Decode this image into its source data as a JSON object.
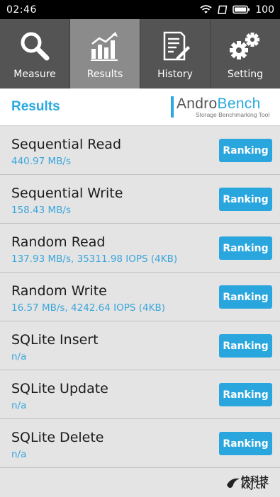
{
  "status_bar": {
    "time": "02:46",
    "battery": "100",
    "icons": [
      "wifi-icon",
      "signal-icon",
      "battery-icon"
    ]
  },
  "tabs": [
    {
      "label": "Measure",
      "icon": "search-icon",
      "active": false
    },
    {
      "label": "Results",
      "icon": "bar-chart-icon",
      "active": true
    },
    {
      "label": "History",
      "icon": "document-edit-icon",
      "active": false
    },
    {
      "label": "Setting",
      "icon": "gears-icon",
      "active": false
    }
  ],
  "header": {
    "title": "Results",
    "brand_name_part1": "Andro",
    "brand_name_part2": "Bench",
    "brand_tagline": "Storage Benchmarking Tool"
  },
  "results": [
    {
      "name": "Sequential Read",
      "value": "440.97 MB/s",
      "button": "Ranking"
    },
    {
      "name": "Sequential Write",
      "value": "158.43 MB/s",
      "button": "Ranking"
    },
    {
      "name": "Random Read",
      "value": "137.93 MB/s, 35311.98 IOPS (4KB)",
      "button": "Ranking"
    },
    {
      "name": "Random Write",
      "value": "16.57 MB/s, 4242.64 IOPS (4KB)",
      "button": "Ranking"
    },
    {
      "name": "SQLite Insert",
      "value": "n/a",
      "button": "Ranking"
    },
    {
      "name": "SQLite Update",
      "value": "n/a",
      "button": "Ranking"
    },
    {
      "name": "SQLite Delete",
      "value": "n/a",
      "button": "Ranking"
    }
  ],
  "watermark": {
    "text": "快科技",
    "sub": "KKJ.CN"
  },
  "colors": {
    "accent": "#29a9e0",
    "tab_bg": "#545454",
    "tab_active": "#8b8b8b",
    "list_bg": "#e4e4e4"
  }
}
